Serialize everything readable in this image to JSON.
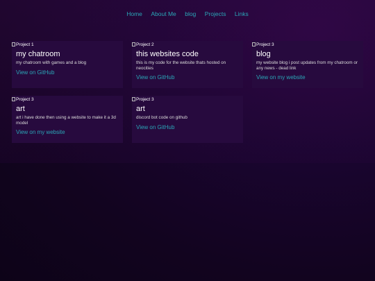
{
  "nav": {
    "items": [
      "Home",
      "About Me",
      "blog",
      "Projects",
      "Links"
    ]
  },
  "projects": [
    {
      "image_alt": "Project 1",
      "title": "my chatroom",
      "description": "my chatroom with games and a blog",
      "link": "View on GitHub"
    },
    {
      "image_alt": "Project 2",
      "title": "this websites code",
      "description": "this is my code for the website thats hosted on neocities",
      "link": "View on GitHub"
    },
    {
      "image_alt": "Project 3",
      "title": "blog",
      "description": "my website blog i post updates from my chatroom or any news - dead link",
      "link": "View on my website"
    },
    {
      "image_alt": "Project 3",
      "title": "art",
      "description": "art i have done then using a website to make it a 3d model",
      "link": "View on my website"
    },
    {
      "image_alt": "Project 3",
      "title": "art",
      "description": "discord bot code on github",
      "link": "View on GitHub"
    }
  ],
  "colors": {
    "accent_link": "#2aa7b8",
    "card_bg": "#270a3e",
    "page_bg": "#12041f"
  }
}
